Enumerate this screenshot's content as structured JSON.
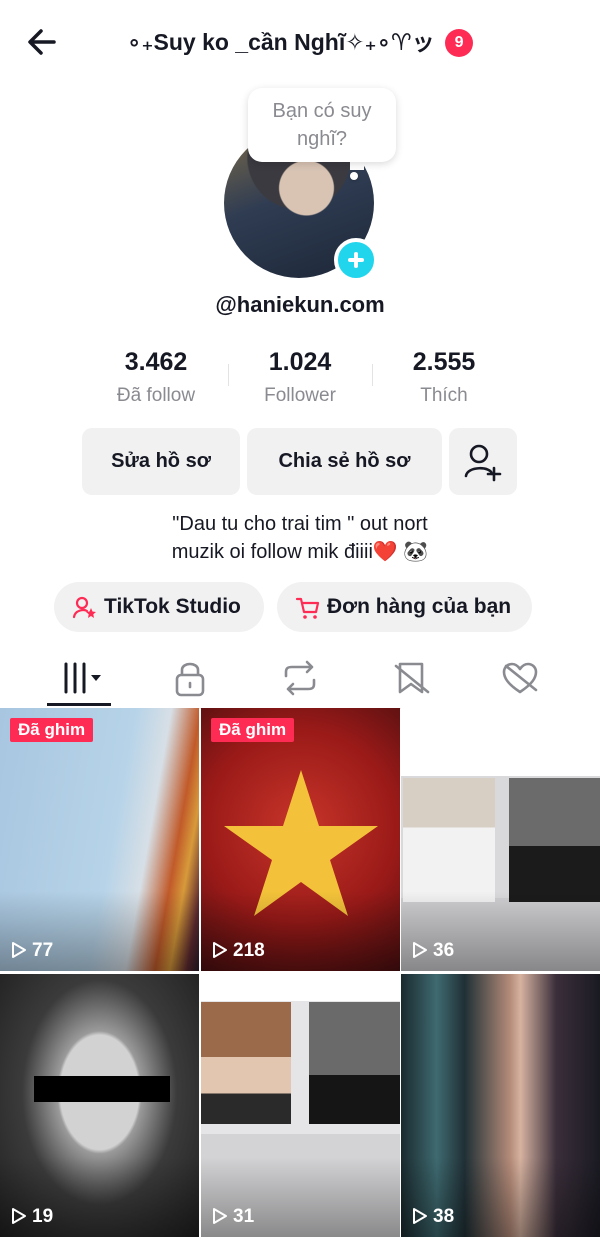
{
  "header": {
    "title": "∘₊Suy ko _cần Nghĩ✧₊∘♈ッ",
    "notification_count": "9"
  },
  "profile": {
    "bubble_text": "Bạn có suy nghĩ?",
    "username": "@haniekun.com",
    "stats": [
      {
        "value": "3.462",
        "label": "Đã follow"
      },
      {
        "value": "1.024",
        "label": "Follower"
      },
      {
        "value": "2.555",
        "label": "Thích"
      }
    ],
    "buttons": {
      "edit_profile": "Sửa hồ sơ",
      "share_profile": "Chia sẻ hồ sơ"
    },
    "bio_line1": "\"Dau tu cho trai tim \" out nort",
    "bio_line2": "muzik oi  follow mik điiii❤️ 🐼",
    "pills": {
      "studio": "TikTok Studio",
      "orders": "Đơn hàng của bạn"
    }
  },
  "tabs": [
    "videos-grid",
    "private",
    "reposts",
    "favorites",
    "liked"
  ],
  "videos": [
    {
      "views": "77",
      "pinned": "Đã ghim"
    },
    {
      "views": "218",
      "pinned": "Đã ghim"
    },
    {
      "views": "36",
      "pinned": ""
    },
    {
      "views": "19",
      "pinned": ""
    },
    {
      "views": "31",
      "pinned": ""
    },
    {
      "views": "38",
      "pinned": ""
    }
  ],
  "colors": {
    "accent_red": "#fe2c55",
    "accent_cyan": "#20d5ec",
    "text_primary": "#161823",
    "text_secondary": "#8a8b91",
    "button_bg": "#f1f1f2"
  }
}
